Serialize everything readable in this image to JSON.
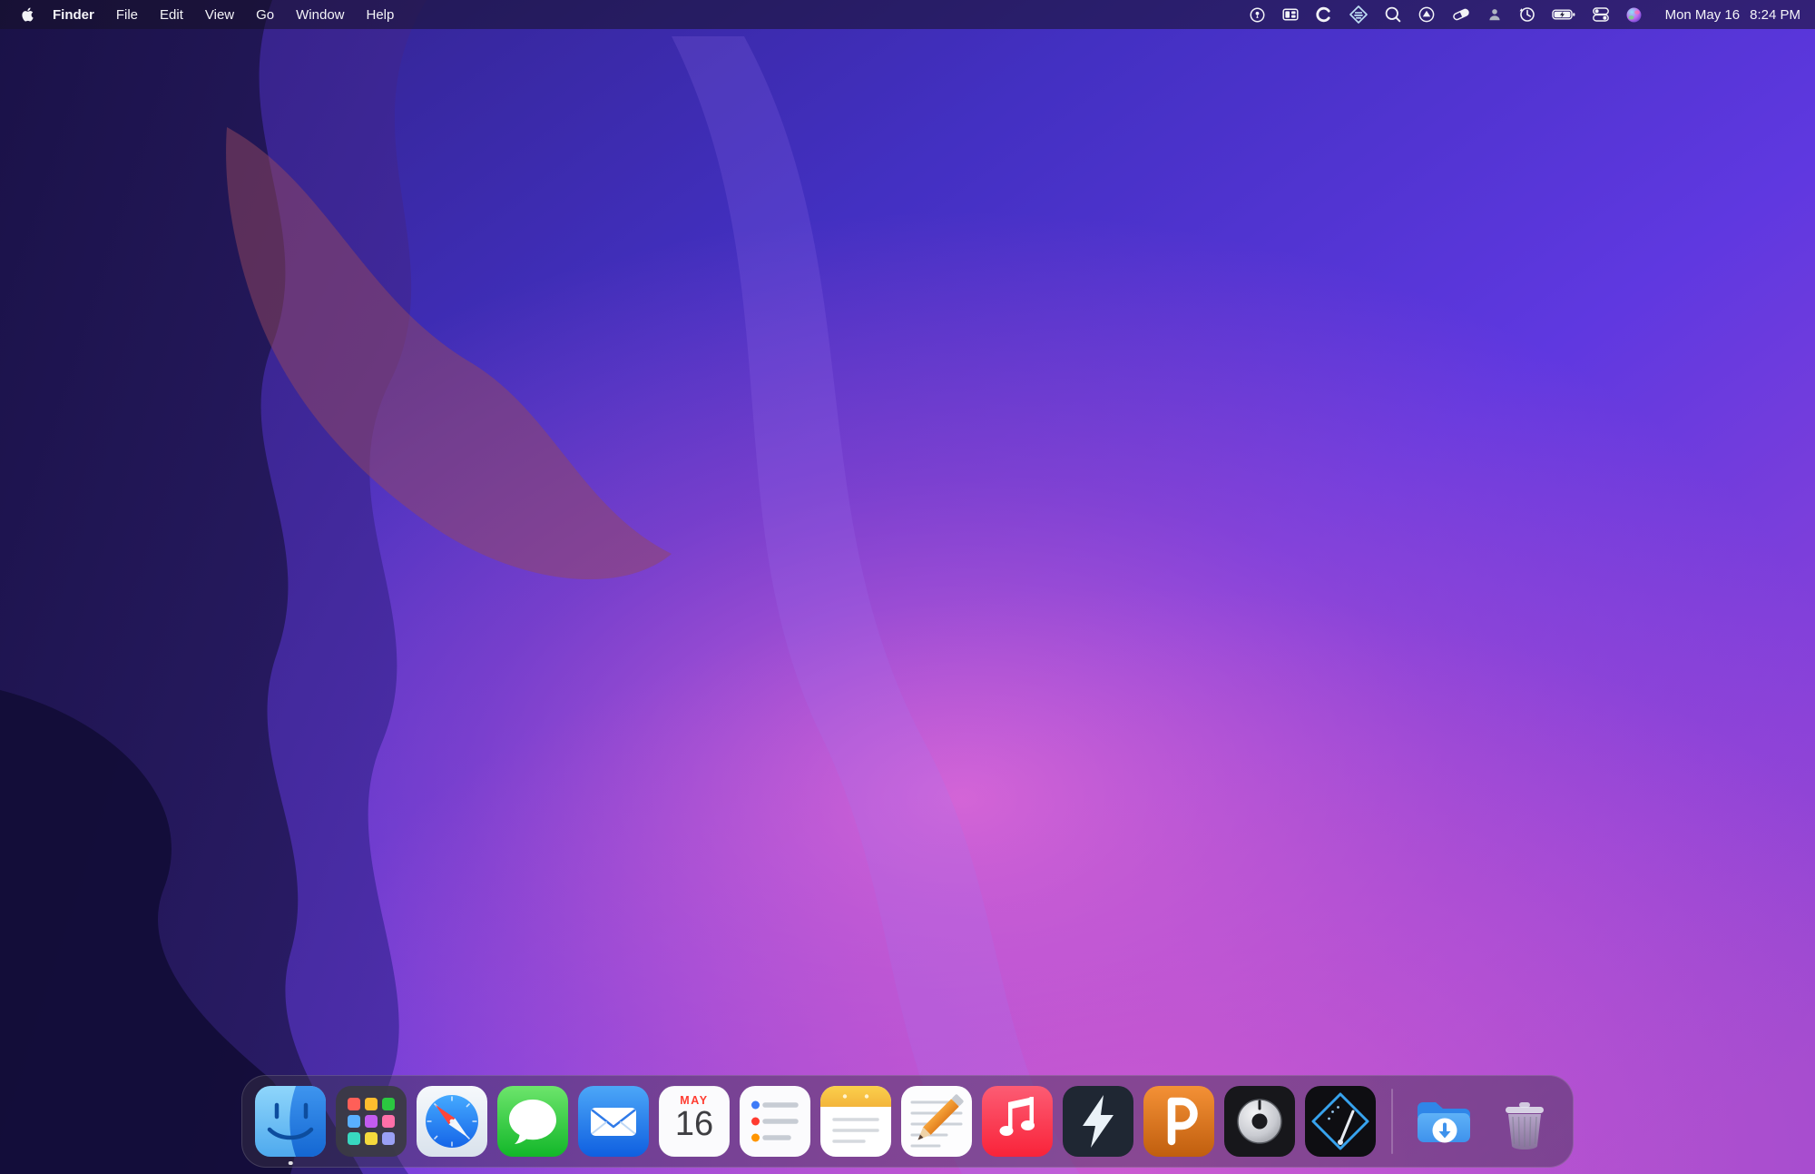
{
  "theme": {
    "menubar_bg": "rgba(22,17,38,0.55)",
    "dock_bg": "rgba(58,52,70,0.45)",
    "wallpaper_palette": [
      "#191145",
      "#2E2184",
      "#4330C2",
      "#5F38E0",
      "#8841D9",
      "#E66FD8"
    ],
    "accent_blue": "#2F86E8"
  },
  "menubar": {
    "apple_icon": "apple-logo",
    "items": [
      {
        "label": "Finder",
        "bold": true
      },
      {
        "label": "File"
      },
      {
        "label": "Edit"
      },
      {
        "label": "View"
      },
      {
        "label": "Go"
      },
      {
        "label": "Window"
      },
      {
        "label": "Help"
      }
    ],
    "status_icons": [
      "keyhole-circle-icon",
      "window-tiles-icon",
      "letter-c-icon",
      "audio-hijack-diamond-icon",
      "spotlight-search-icon",
      "eject-circle-icon",
      "pill-icon",
      "person-icon",
      "time-machine-icon",
      "battery-charging-icon",
      "control-center-icon",
      "siri-icon"
    ],
    "clock": {
      "date": "Mon May 16",
      "time": "8:24 PM"
    }
  },
  "dock": {
    "items": [
      "finder",
      "launchpad",
      "safari",
      "messages",
      "mail",
      "calendar",
      "reminders",
      "notes",
      "textedit",
      "music",
      "fission",
      "piezo",
      "soundsource",
      "audio-hijack",
      "downloads",
      "trash"
    ],
    "calendar": {
      "month": "MAY",
      "day": "16"
    },
    "finder_running": true
  }
}
